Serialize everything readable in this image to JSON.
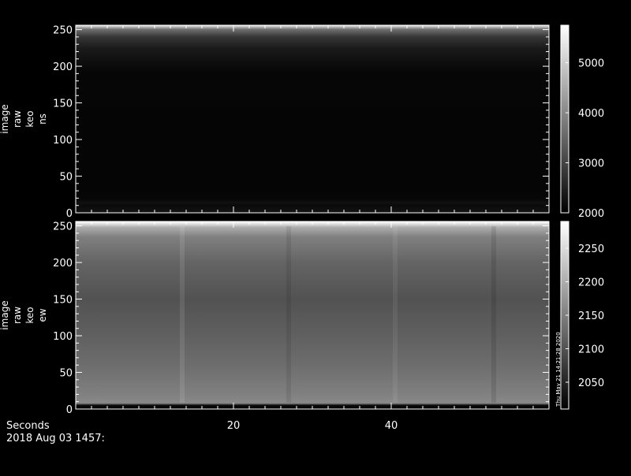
{
  "chart_data": [
    {
      "type": "heatmap",
      "panel": "top",
      "ylabel_lines": [
        "image",
        "raw",
        "keo",
        "ns"
      ],
      "yticks": [
        0,
        50,
        100,
        150,
        200,
        250
      ],
      "ylim": [
        0,
        256
      ],
      "xlim": [
        0,
        60
      ],
      "colorbar": {
        "ticks": [
          2000,
          3000,
          4000,
          5000
        ],
        "range": [
          2000,
          5750
        ]
      },
      "rows": [
        {
          "y": 0,
          "v": 2300
        },
        {
          "y": 6,
          "v": 2200
        },
        {
          "y": 10,
          "v": 2150
        },
        {
          "y": 14,
          "v": 2250
        },
        {
          "y": 18,
          "v": 2100
        },
        {
          "y": 30,
          "v": 2080
        },
        {
          "y": 120,
          "v": 2070
        },
        {
          "y": 190,
          "v": 2090
        },
        {
          "y": 205,
          "v": 2200
        },
        {
          "y": 225,
          "v": 2400
        },
        {
          "y": 240,
          "v": 2800
        },
        {
          "y": 250,
          "v": 3600
        },
        {
          "y": 254,
          "v": 4800
        },
        {
          "y": 256,
          "v": 5600
        }
      ]
    },
    {
      "type": "heatmap",
      "panel": "bottom",
      "ylabel_lines": [
        "image",
        "raw",
        "keo",
        "ew"
      ],
      "yticks": [
        0,
        50,
        100,
        150,
        200,
        250
      ],
      "ylim": [
        0,
        256
      ],
      "xlim": [
        0,
        60
      ],
      "xticks": [
        20,
        40
      ],
      "colorbar": {
        "ticks": [
          2050,
          2100,
          2150,
          2200,
          2250
        ],
        "range": [
          2010,
          2290
        ]
      },
      "rows": [
        {
          "y": 0,
          "v": 2010
        },
        {
          "y": 5,
          "v": 2020
        },
        {
          "y": 8,
          "v": 2160
        },
        {
          "y": 20,
          "v": 2150
        },
        {
          "y": 60,
          "v": 2130
        },
        {
          "y": 100,
          "v": 2115
        },
        {
          "y": 150,
          "v": 2100
        },
        {
          "y": 200,
          "v": 2120
        },
        {
          "y": 235,
          "v": 2150
        },
        {
          "y": 248,
          "v": 2200
        },
        {
          "y": 253,
          "v": 2260
        },
        {
          "y": 256,
          "v": 2290
        }
      ],
      "vertical_streaks": [
        {
          "x": 13.5,
          "dv": 12
        },
        {
          "x": 27,
          "dv": -10
        },
        {
          "x": 40.5,
          "dv": 8
        },
        {
          "x": 53,
          "dv": -12
        }
      ]
    }
  ],
  "footer": {
    "xlabel": "Seconds",
    "date_text": "2018 Aug 03 1457:",
    "side_stamp": "Thu May 21 14:21:28 2020"
  },
  "colors": {
    "background": "#000000",
    "foreground": "#ffffff"
  }
}
